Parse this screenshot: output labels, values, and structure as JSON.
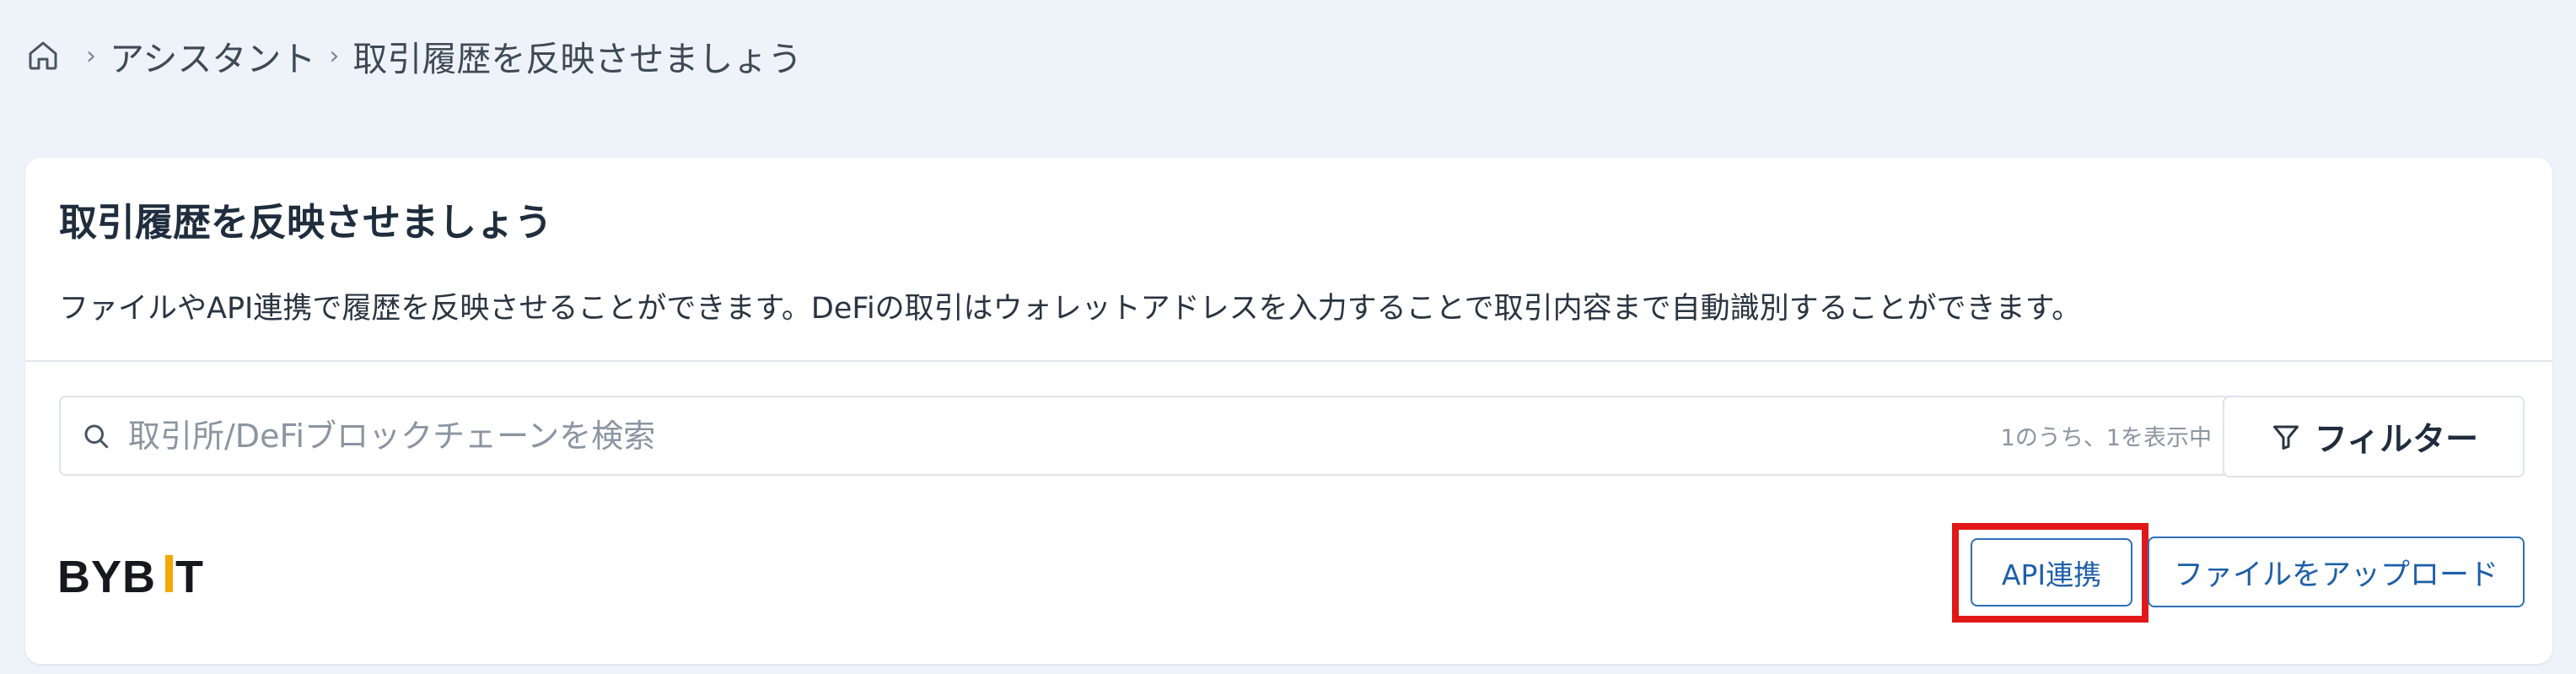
{
  "breadcrumb": {
    "home_icon": "home-icon",
    "items": [
      "アシスタント",
      "取引履歴を反映させましょう"
    ],
    "separator": "›"
  },
  "card": {
    "title": "取引履歴を反映させましょう",
    "description": "ファイルやAPI連携で履歴を反映させることができます。DeFiの取引はウォレットアドレスを入力することで取引内容まで自動識別することができます。"
  },
  "search": {
    "icon": "search-icon",
    "placeholder": "取引所/DeFiブロックチェーンを検索",
    "value": "",
    "result_count": "1のうち、1を表示中"
  },
  "filter": {
    "icon": "filter-icon",
    "label": "フィルター"
  },
  "exchange": {
    "logo_text": "BYBIT",
    "api_button": "API連携",
    "upload_button": "ファイルをアップロード"
  },
  "colors": {
    "background": "#eef3fa",
    "card": "#ffffff",
    "accent": "#2e6fb8",
    "highlight": "#e01818",
    "bybit_yellow": "#f7a600"
  }
}
